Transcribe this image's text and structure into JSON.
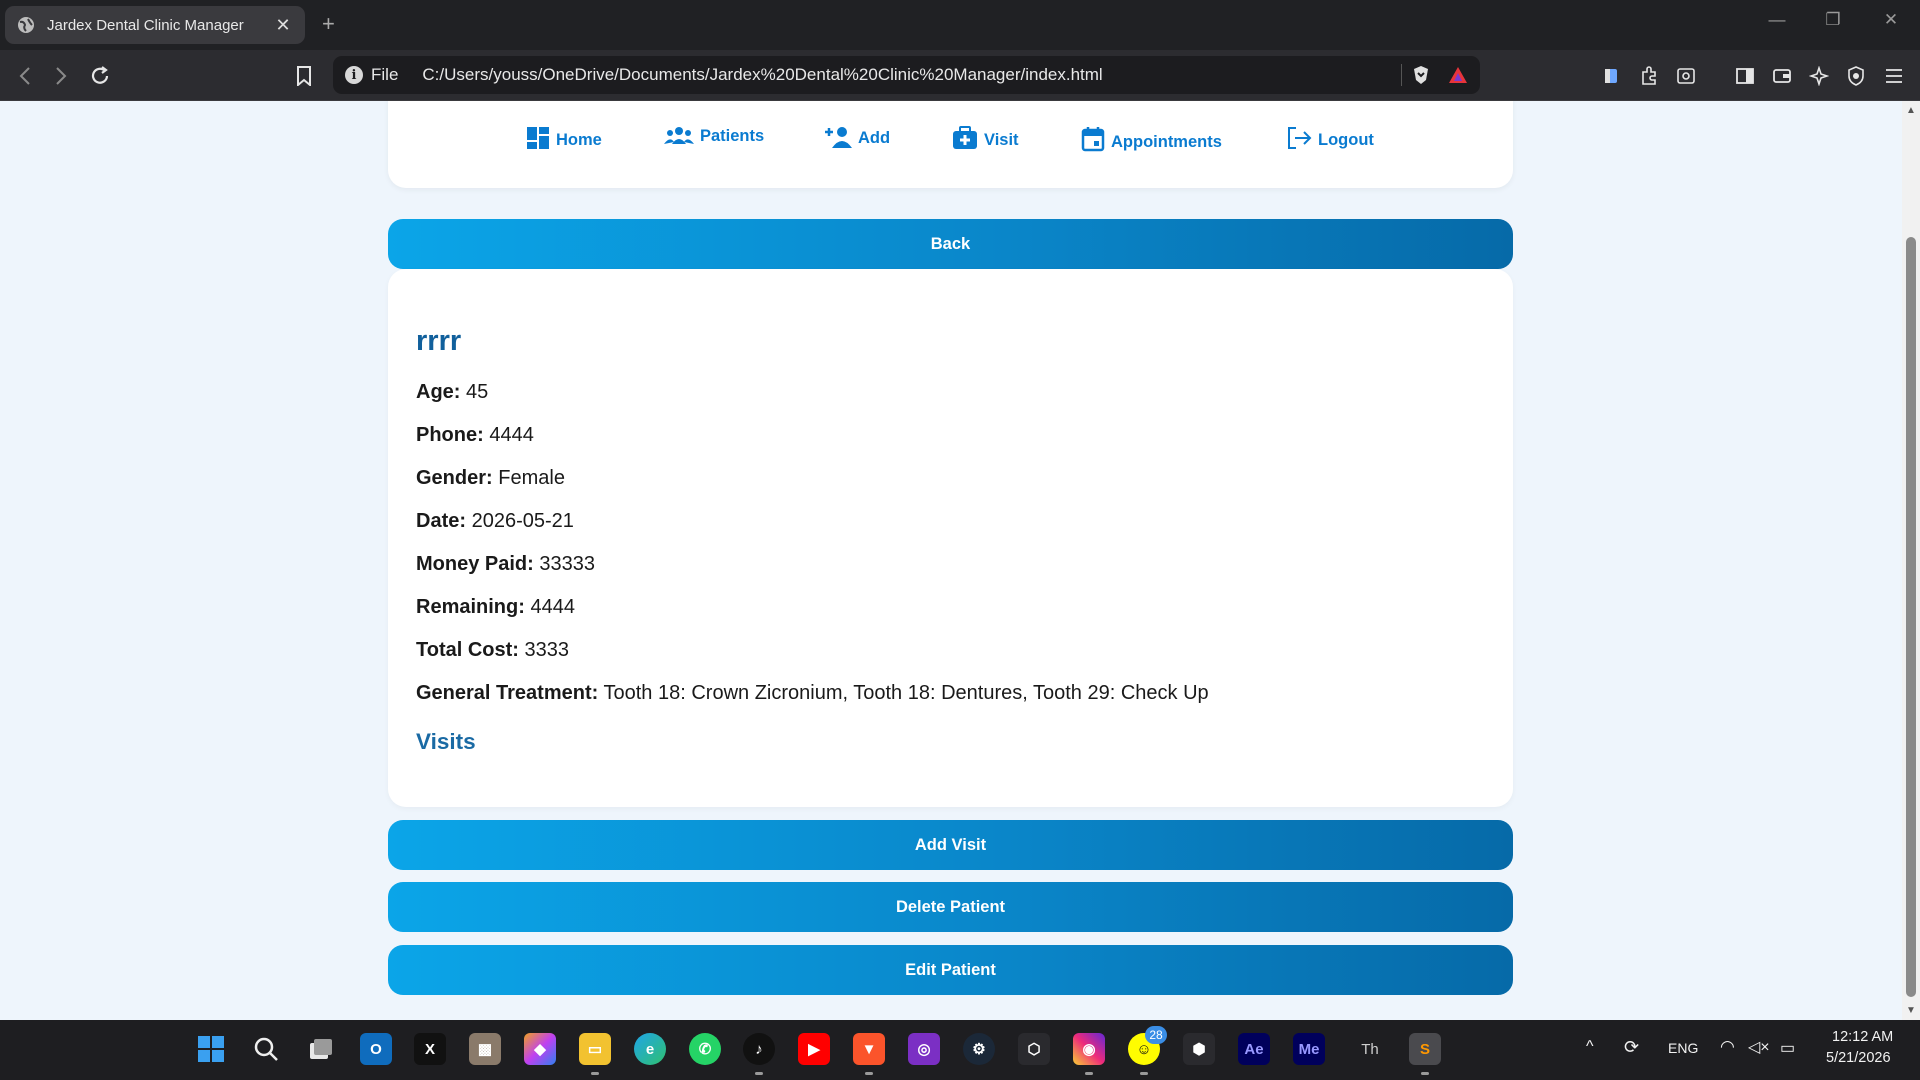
{
  "browser": {
    "tab_title": "Jardex Dental Clinic Manager",
    "tab_close": "✕",
    "new_tab": "+",
    "omnibox_scheme": "File",
    "url": "C:/Users/youss/OneDrive/Documents/Jardex%20Dental%20Clinic%20Manager/index.html"
  },
  "nav": {
    "items": [
      {
        "label": "Home",
        "icon": "dashboard-icon"
      },
      {
        "label": "Patients",
        "icon": "users-icon"
      },
      {
        "label": "Add",
        "icon": "user-plus-icon"
      },
      {
        "label": "Visit",
        "icon": "medical-kit-icon"
      },
      {
        "label": "Appointments",
        "icon": "calendar-icon"
      },
      {
        "label": "Logout",
        "icon": "logout-icon"
      }
    ]
  },
  "buttons": {
    "back": "Back",
    "add_visit": "Add Visit",
    "delete_patient": "Delete Patient",
    "edit_patient": "Edit Patient"
  },
  "patient": {
    "name": "rrrr",
    "fields": [
      {
        "label": "Age:",
        "value": "45"
      },
      {
        "label": "Phone:",
        "value": "4444"
      },
      {
        "label": "Gender:",
        "value": "Female"
      },
      {
        "label": "Date:",
        "value": "2026-05-21"
      },
      {
        "label": "Money Paid:",
        "value": "33333"
      },
      {
        "label": "Remaining:",
        "value": "4444"
      },
      {
        "label": "Total Cost:",
        "value": "3333"
      },
      {
        "label": "General Treatment:",
        "value": "Tooth 18: Crown Zicronium, Tooth 18: Dentures, Tooth 29: Check Up"
      }
    ],
    "visits_heading": "Visits"
  },
  "taskbar": {
    "apps": [
      "Ae",
      "Me",
      "Th"
    ],
    "notification_badge": "28",
    "language": "ENG",
    "time": "12:12 AM",
    "date": "5/21/2026"
  },
  "colors": {
    "accent": "#0a7bd0",
    "heading": "#11609c",
    "button_start": "#0ba5e8",
    "button_end": "#066aa8",
    "page_bg": "#eef5fc"
  }
}
